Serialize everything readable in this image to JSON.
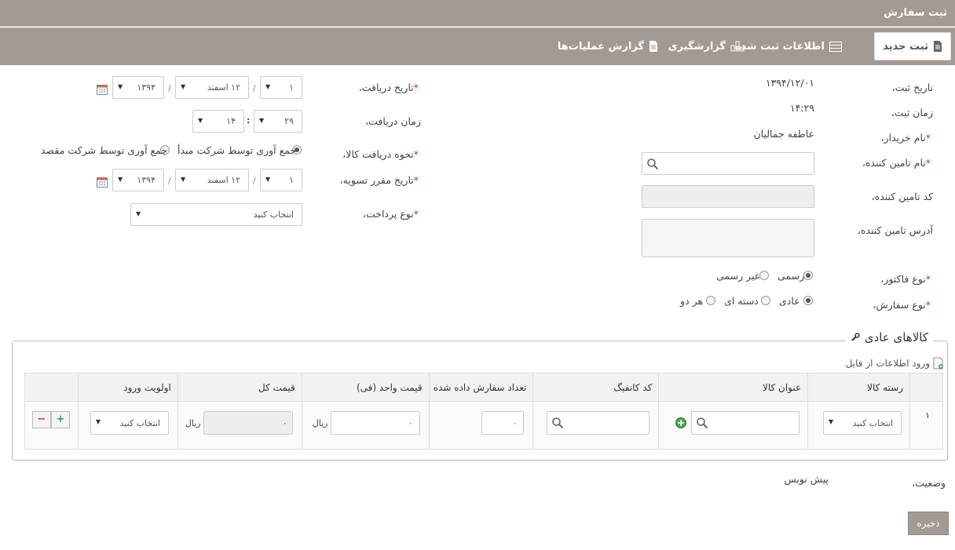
{
  "window": {
    "title": "ثبت سفارش"
  },
  "toolbar": {
    "new": "ثبت جدید",
    "registered": "اطلاعات ثبت شده",
    "reporting": "گزارشگیری",
    "ops_report": "گزارش عملیات‌ها"
  },
  "form_right": {
    "reg_date": {
      "label": "تاریخ ثبت،",
      "value": "۱۳۹۴/۱۲/۰۱"
    },
    "reg_time": {
      "label": "زمان ثبت،",
      "value": "۱۴:۲۹"
    },
    "buyer": {
      "label": "نام خریدار،",
      "value": "عاطفه جمالیان"
    },
    "supplier_name": {
      "label": "نام تامین کننده،"
    },
    "supplier_code": {
      "label": "کد تامین کننده،"
    },
    "supplier_address": {
      "label": "آدرس تامین کننده،"
    },
    "invoice_type": {
      "label": "نوع فاکتور،",
      "options": [
        "رسمی",
        "غیر رسمی"
      ],
      "selected": "رسمی"
    },
    "order_type": {
      "label": "نوع سفارش،",
      "options": [
        "عادی",
        "دسته ای",
        "هر دو"
      ],
      "selected": "عادی"
    }
  },
  "form_left": {
    "receive_date": {
      "label": "تاریخ دریافت،",
      "day": "۱",
      "month": "۱۲ اسفند",
      "year": "۱۳۹۴"
    },
    "receive_time": {
      "label": "زمان دریافت،",
      "minute": "۲۹",
      "hour": "۱۴"
    },
    "receive_method": {
      "label": "نحوه دریافت کالا،",
      "options": [
        "جمع آوری توسط شرکت مبدأ",
        "جمع آوری توسط شرکت مقصد"
      ],
      "selected": "جمع آوری توسط شرکت مبدأ"
    },
    "settle_date": {
      "label": "تاریخ مقرر تسویه،",
      "day": "۱",
      "month": "۱۲ اسفند",
      "year": "۱۳۹۴"
    },
    "payment_type": {
      "label": "نوع پرداخت،",
      "value": "انتخاب کنید"
    }
  },
  "required_mark": "*",
  "date_sep": "/",
  "time_sep": ":",
  "goods": {
    "title": "کالاهای عادی",
    "file_import": "ورود اطلاعات از فایل",
    "columns": [
      "رسته کالا",
      "عنوان کالا",
      "کد کانفیگ",
      "تعداد سفارش داده شده",
      "قیمت واحد (فی)",
      "قیمت کل",
      "اولویت ورود"
    ],
    "rows": [
      {
        "index": "۱",
        "category": "انتخاب کنید",
        "qty": "۰",
        "unit_price": "۰",
        "unit_price_unit": "ریال",
        "total": "۰",
        "total_unit": "ریال",
        "priority": "انتخاب کنید"
      }
    ]
  },
  "status": {
    "label": "وضعیت،",
    "value": "پیش نویس"
  },
  "save": "ذخیره",
  "colors": {
    "toolbar_bg": "#a29a94",
    "required": "#e02020",
    "plus": "#3a9a3a",
    "minus": "#d03030"
  }
}
